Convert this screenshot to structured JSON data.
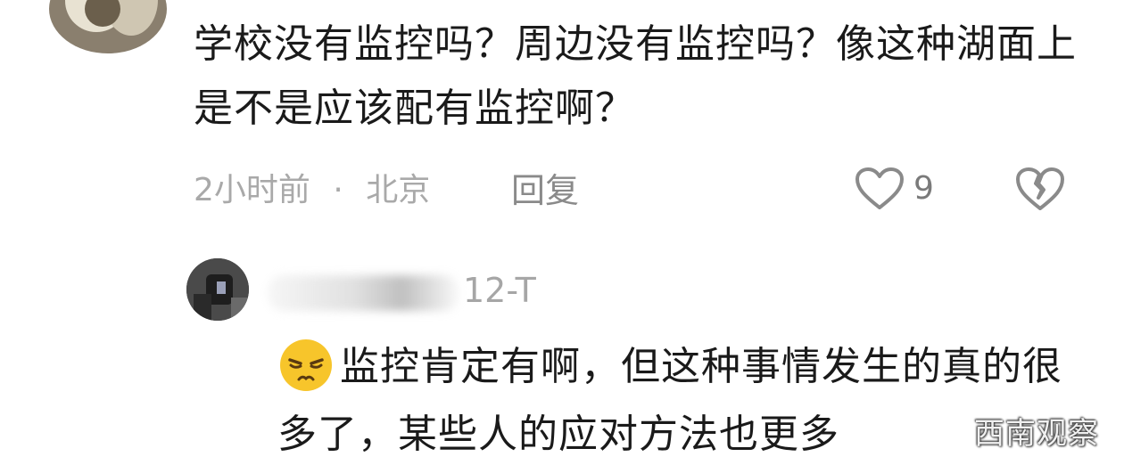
{
  "comment": {
    "text": "学校没有监控吗？周边没有监控吗？像这种湖面上是不是应该配有监控啊？",
    "time": "2小时前",
    "separator": "·",
    "location": "北京",
    "reply_label": "回复",
    "like_count": "9",
    "like_icon": "heart-outline-icon",
    "dislike_icon": "broken-heart-icon"
  },
  "reply": {
    "author_visible": "12-T",
    "emoji": "squinting-face-emoji",
    "text": "监控肯定有啊，但这种事情发生的真的很多了，某些人的应对方法也更多"
  },
  "watermark": {
    "text": "西南观察"
  },
  "colors": {
    "text_primary": "#1a1a1a",
    "text_secondary": "#a9a9a9",
    "icon_gray": "#8a8a8a",
    "emoji_yellow": "#f7c52b"
  }
}
